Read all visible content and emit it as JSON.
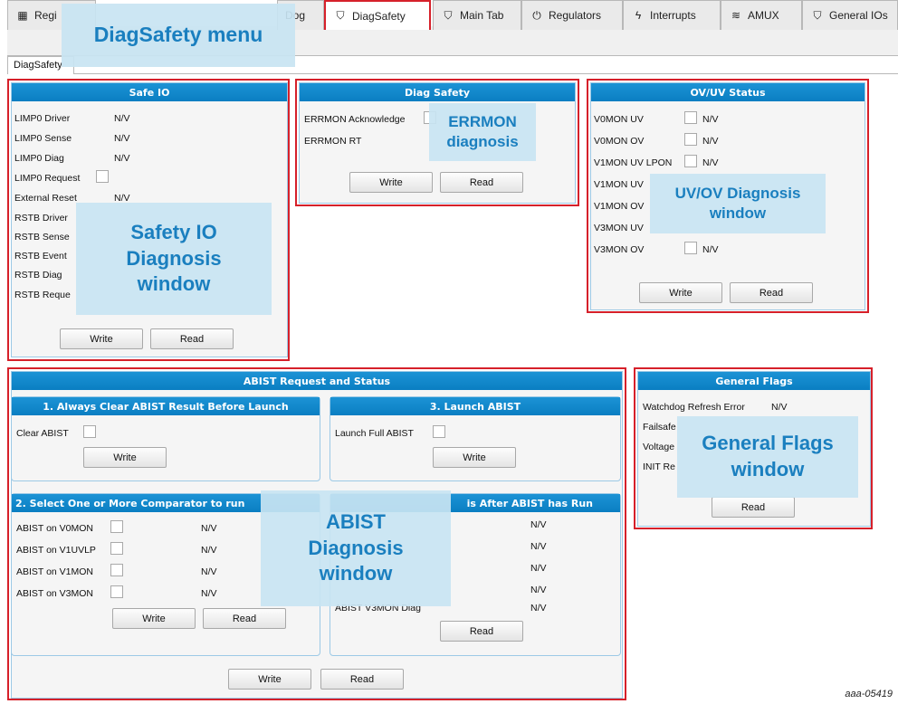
{
  "tabs": [
    {
      "label": "Regi",
      "icon": "register-icon",
      "glyph": "▦"
    },
    {
      "label": "Dog",
      "icon": "watchdog-icon",
      "glyph": ""
    },
    {
      "label": "DiagSafety",
      "icon": "shield-check-icon",
      "glyph": "⛉"
    },
    {
      "label": "Main Tab",
      "icon": "shield-check-icon",
      "glyph": "⛉"
    },
    {
      "label": "Regulators",
      "icon": "power-icon",
      "glyph": "⏻"
    },
    {
      "label": "Interrupts",
      "icon": "lightning-icon",
      "glyph": "ϟ"
    },
    {
      "label": "AMUX",
      "icon": "signal-icon",
      "glyph": "≋"
    },
    {
      "label": "General IOs",
      "icon": "shield-check-icon",
      "glyph": "⛉"
    }
  ],
  "subtab": "DiagSafety",
  "safe_io": {
    "title": "Safe IO",
    "rows": [
      {
        "label": "LIMP0 Driver",
        "value": "N/V"
      },
      {
        "label": "LIMP0 Sense",
        "value": "N/V"
      },
      {
        "label": "LIMP0 Diag",
        "value": "N/V"
      },
      {
        "label": "LIMP0 Request",
        "value": ""
      },
      {
        "label": "External Reset",
        "value": "N/V"
      },
      {
        "label": "RSTB Driver",
        "value": ""
      },
      {
        "label": "RSTB Sense",
        "value": ""
      },
      {
        "label": "RSTB Event",
        "value": ""
      },
      {
        "label": "RSTB Diag",
        "value": ""
      },
      {
        "label": "RSTB Reque",
        "value": ""
      }
    ],
    "write": "Write",
    "read": "Read"
  },
  "diag_safety": {
    "title": "Diag Safety",
    "rows": [
      "ERRMON Acknowledge",
      "ERRMON RT"
    ],
    "write": "Write",
    "read": "Read"
  },
  "ovuv": {
    "title": "OV/UV Status",
    "rows": [
      {
        "label": "V0MON UV",
        "value": "N/V"
      },
      {
        "label": "V0MON OV",
        "value": "N/V"
      },
      {
        "label": "V1MON UV LPON",
        "value": "N/V"
      },
      {
        "label": "V1MON UV",
        "value": ""
      },
      {
        "label": "V1MON OV",
        "value": ""
      },
      {
        "label": "V3MON UV",
        "value": ""
      },
      {
        "label": "V3MON OV",
        "value": "N/V"
      }
    ],
    "write": "Write",
    "read": "Read"
  },
  "abist": {
    "title": "ABIST Request and Status",
    "clear": {
      "title": "1. Always Clear ABIST Result Before Launch",
      "label": "Clear ABIST",
      "write": "Write"
    },
    "launch": {
      "title": "3. Launch ABIST",
      "label": "Launch Full ABIST",
      "write": "Write"
    },
    "select": {
      "title": "2. Select One or More Comparator to run",
      "rows": [
        {
          "label": "ABIST on V0MON",
          "value": "N/V"
        },
        {
          "label": "ABIST on V1UVLP",
          "value": "N/V"
        },
        {
          "label": "ABIST on V1MON",
          "value": "N/V"
        },
        {
          "label": "ABIST on V3MON",
          "value": "N/V"
        }
      ],
      "write": "Write",
      "read": "Read"
    },
    "results": {
      "title": "is After ABIST has Run",
      "values": [
        "N/V",
        "N/V",
        "N/V",
        "N/V",
        "N/V"
      ],
      "last_label": "ABIST V3MON Diag",
      "read": "Read"
    },
    "write": "Write",
    "read": "Read"
  },
  "general_flags": {
    "title": "General Flags",
    "rows": [
      "Watchdog Refresh Error",
      "Failsafe",
      "Voltage",
      "INIT Re"
    ],
    "first_value": "N/V",
    "read": "Read"
  },
  "overlays": {
    "diagsafety_menu": "DiagSafety menu",
    "safety_io": "Safety IO Diagnosis window",
    "errmon": "ERRMON diagnosis",
    "uvov": "UV/OV Diagnosis window",
    "general_flags": "General Flags window",
    "abist": "ABIST Diagnosis window"
  },
  "figure_id": "aaa-05419",
  "colors": {
    "accent": "#0a7ec2",
    "highlight": "#d6202a",
    "overlay_text": "#1a7fbf"
  }
}
